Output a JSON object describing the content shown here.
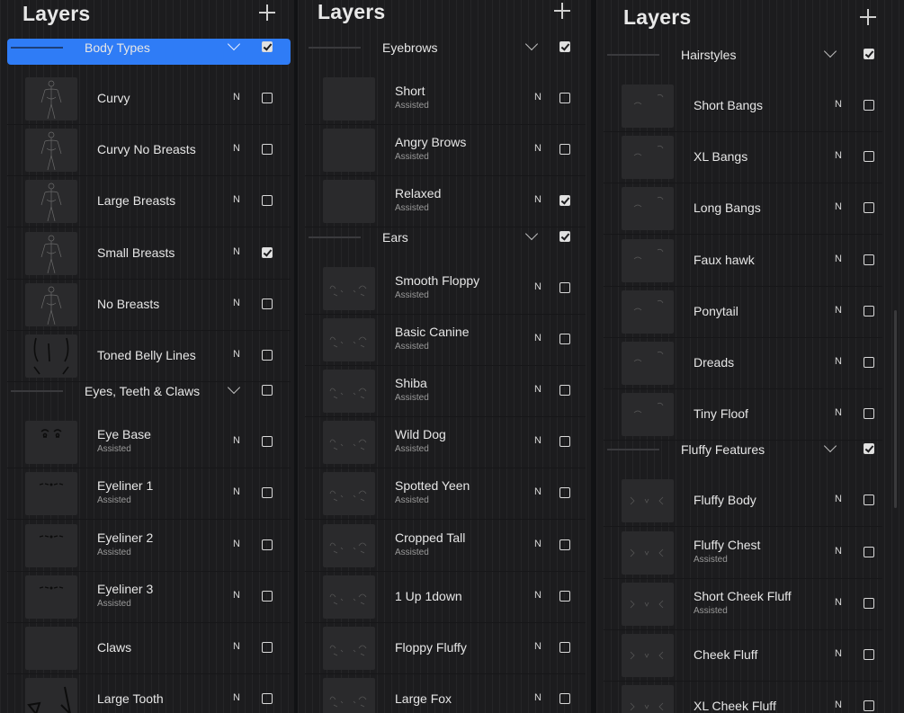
{
  "panels": [
    {
      "title": "Layers",
      "groups": [
        {
          "name": "Body Types",
          "visible": true,
          "selected": true,
          "layers": [
            {
              "name": "Curvy",
              "mode": "N",
              "visible": false,
              "thumb": "body-figure"
            },
            {
              "name": "Curvy No Breasts",
              "mode": "N",
              "visible": false,
              "thumb": "body-figure"
            },
            {
              "name": "Large Breasts",
              "mode": "N",
              "visible": false,
              "thumb": "body-figure"
            },
            {
              "name": "Small Breasts",
              "mode": "N",
              "visible": true,
              "thumb": "body-figure"
            },
            {
              "name": "No Breasts",
              "mode": "N",
              "visible": false,
              "thumb": "body-figure"
            },
            {
              "name": "Toned Belly Lines",
              "mode": "N",
              "visible": false,
              "thumb": "belly-lines"
            }
          ]
        },
        {
          "name": "Eyes, Teeth & Claws",
          "visible": false,
          "selected": false,
          "layers": [
            {
              "name": "Eye Base",
              "sub": "Assisted",
              "mode": "N",
              "visible": false,
              "thumb": "eyes"
            },
            {
              "name": "Eyeliner 1",
              "sub": "Assisted",
              "mode": "N",
              "visible": false,
              "thumb": "eyeliner"
            },
            {
              "name": "Eyeliner 2",
              "sub": "Assisted",
              "mode": "N",
              "visible": false,
              "thumb": "eyeliner"
            },
            {
              "name": "Eyeliner 3",
              "sub": "Assisted",
              "mode": "N",
              "visible": false,
              "thumb": "eyeliner"
            },
            {
              "name": "Claws",
              "mode": "N",
              "visible": false,
              "thumb": "blank"
            },
            {
              "name": "Large Tooth",
              "mode": "N",
              "visible": false,
              "thumb": "tooth"
            }
          ]
        }
      ]
    },
    {
      "title": "Layers",
      "groups": [
        {
          "name": "Eyebrows",
          "visible": true,
          "selected": false,
          "layers": [
            {
              "name": "Short",
              "sub": "Assisted",
              "mode": "N",
              "visible": false,
              "thumb": "blank"
            },
            {
              "name": "Angry Brows",
              "sub": "Assisted",
              "mode": "N",
              "visible": false,
              "thumb": "blank"
            },
            {
              "name": "Relaxed",
              "sub": "Assisted",
              "mode": "N",
              "visible": true,
              "thumb": "blank"
            }
          ]
        },
        {
          "name": "Ears",
          "visible": true,
          "selected": false,
          "layers": [
            {
              "name": "Smooth Floppy",
              "sub": "Assisted",
              "mode": "N",
              "visible": false,
              "thumb": "ears"
            },
            {
              "name": "Basic Canine",
              "sub": "Assisted",
              "mode": "N",
              "visible": false,
              "thumb": "ears"
            },
            {
              "name": "Shiba",
              "sub": "Assisted",
              "mode": "N",
              "visible": false,
              "thumb": "ears"
            },
            {
              "name": "Wild Dog",
              "sub": "Assisted",
              "mode": "N",
              "visible": false,
              "thumb": "ears"
            },
            {
              "name": "Spotted Yeen",
              "sub": "Assisted",
              "mode": "N",
              "visible": false,
              "thumb": "ears"
            },
            {
              "name": "Cropped Tall",
              "sub": "Assisted",
              "mode": "N",
              "visible": false,
              "thumb": "ears"
            },
            {
              "name": "1 Up 1down",
              "mode": "N",
              "visible": false,
              "thumb": "ears"
            },
            {
              "name": "Floppy Fluffy",
              "mode": "N",
              "visible": false,
              "thumb": "ears"
            },
            {
              "name": "Large Fox",
              "mode": "N",
              "visible": false,
              "thumb": "ears"
            }
          ]
        }
      ]
    },
    {
      "title": "Layers",
      "groups": [
        {
          "name": "Hairstyles",
          "visible": true,
          "selected": false,
          "layers": [
            {
              "name": "Short Bangs",
              "mode": "N",
              "visible": false,
              "thumb": "hair"
            },
            {
              "name": "XL Bangs",
              "mode": "N",
              "visible": false,
              "thumb": "hair"
            },
            {
              "name": "Long Bangs",
              "mode": "N",
              "visible": false,
              "thumb": "hair"
            },
            {
              "name": "Faux hawk",
              "mode": "N",
              "visible": false,
              "thumb": "hair"
            },
            {
              "name": "Ponytail",
              "mode": "N",
              "visible": false,
              "thumb": "hair"
            },
            {
              "name": "Dreads",
              "mode": "N",
              "visible": false,
              "thumb": "hair"
            },
            {
              "name": "Tiny Floof",
              "mode": "N",
              "visible": false,
              "thumb": "hair"
            }
          ]
        },
        {
          "name": "Fluffy Features",
          "visible": true,
          "selected": false,
          "layers": [
            {
              "name": "Fluffy Body",
              "mode": "N",
              "visible": false,
              "thumb": "fluff"
            },
            {
              "name": "Fluffy Chest",
              "sub": "Assisted",
              "mode": "N",
              "visible": false,
              "thumb": "fluff"
            },
            {
              "name": "Short Cheek Fluff",
              "sub": "Assisted",
              "mode": "N",
              "visible": false,
              "thumb": "fluff"
            },
            {
              "name": "Cheek Fluff",
              "mode": "N",
              "visible": false,
              "thumb": "fluff"
            },
            {
              "name": "XL Cheek Fluff",
              "mode": "N",
              "visible": false,
              "thumb": "fluff"
            }
          ]
        }
      ]
    }
  ],
  "colors": {
    "panel_bg": "#1c1c1e",
    "selected_bg": "#2f7cf6",
    "text": "#e6e6e6",
    "subtext": "#9a9a9a"
  }
}
